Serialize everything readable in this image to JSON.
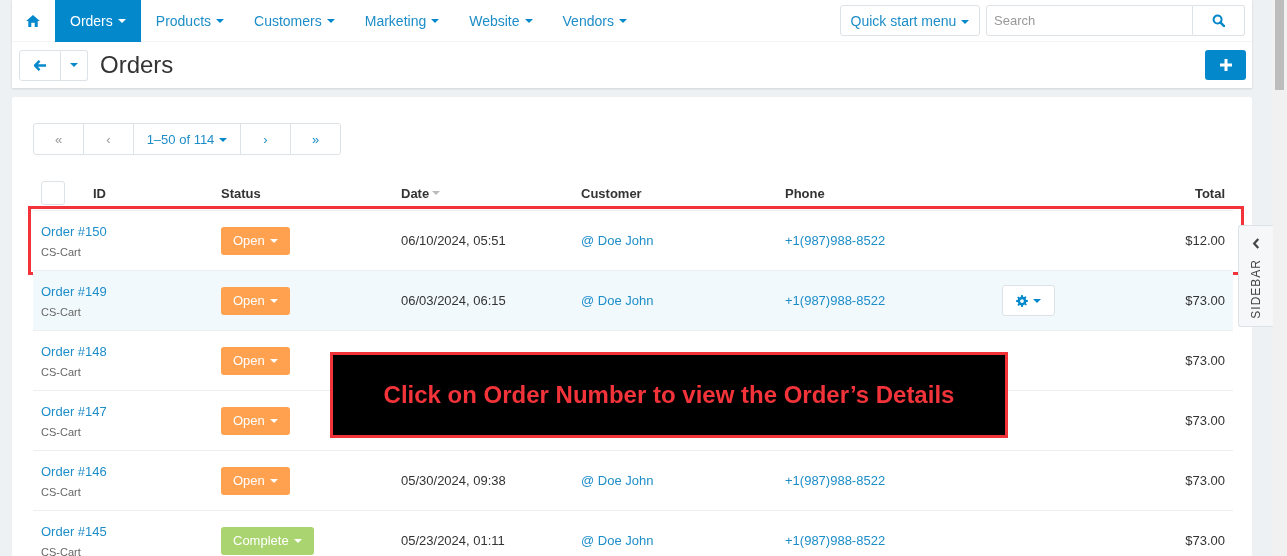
{
  "nav": {
    "items": [
      {
        "label": "Orders",
        "selected": true
      },
      {
        "label": "Products",
        "selected": false
      },
      {
        "label": "Customers",
        "selected": false
      },
      {
        "label": "Marketing",
        "selected": false
      },
      {
        "label": "Website",
        "selected": false
      },
      {
        "label": "Vendors",
        "selected": false
      }
    ],
    "quick_menu": "Quick start menu",
    "search": {
      "placeholder": "Search"
    }
  },
  "page_title": "Orders",
  "pager": {
    "first": "«",
    "prev": "‹",
    "range": "1–50 of 114",
    "next": "›",
    "last": "»"
  },
  "table": {
    "select_all_checked": false,
    "columns": [
      "ID",
      "Status",
      "Date",
      "Customer",
      "Phone",
      "Total"
    ],
    "rows": [
      {
        "id": "Order #150",
        "store": "CS-Cart",
        "status": "Open",
        "kind": "open",
        "date": "06/10/2024, 05:51",
        "customer": "@ Doe John",
        "phone": "+1(987)988-8522",
        "total": "$12.00",
        "hovered": false,
        "framed": true
      },
      {
        "id": "Order #149",
        "store": "CS-Cart",
        "status": "Open",
        "kind": "open",
        "date": "06/03/2024, 06:15",
        "customer": "@ Doe John",
        "phone": "+1(987)988-8522",
        "total": "$73.00",
        "hovered": true,
        "framed": false
      },
      {
        "id": "Order #148",
        "store": "CS-Cart",
        "status": "Open",
        "kind": "open",
        "total": "$73.00",
        "hovered": false,
        "framed": false
      },
      {
        "id": "Order #147",
        "store": "CS-Cart",
        "status": "Open",
        "kind": "open",
        "total": "$73.00",
        "hovered": false,
        "framed": false
      },
      {
        "id": "Order #146",
        "store": "CS-Cart",
        "status": "Open",
        "kind": "open",
        "date": "05/30/2024, 09:38",
        "customer": "@ Doe John",
        "phone": "+1(987)988-8522",
        "total": "$73.00",
        "hovered": false,
        "framed": false
      },
      {
        "id": "Order #145",
        "store": "CS-Cart",
        "status": "Complete",
        "kind": "complete",
        "date": "05/23/2024, 01:11",
        "customer": "@ Doe John",
        "phone": "+1(987)988-8522",
        "total": "$73.00",
        "hovered": false,
        "framed": false
      }
    ]
  },
  "sidebar_tab": "SIDEBAR",
  "callout": "Click on Order Number to view the Order’s Details"
}
